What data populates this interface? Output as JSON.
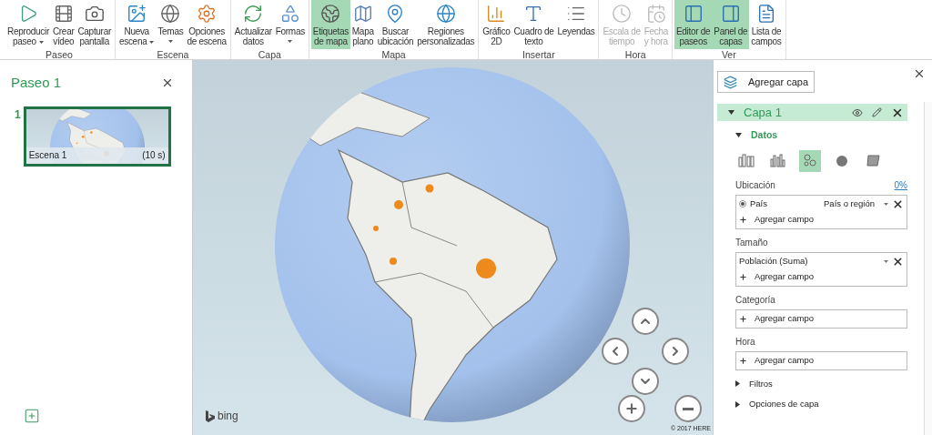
{
  "ribbon": {
    "groups": [
      {
        "label": "Paseo",
        "buttons": [
          {
            "kind": "play",
            "lines": [
              "Reproducir",
              "paseo"
            ],
            "dropdown": true,
            "selected": false,
            "disabled": false
          },
          {
            "kind": "video",
            "lines": [
              "Crear",
              "vídeo"
            ],
            "dropdown": false,
            "selected": false,
            "disabled": false
          },
          {
            "kind": "camera",
            "lines": [
              "Capturar",
              "pantalla"
            ],
            "dropdown": false,
            "selected": false,
            "disabled": false
          }
        ]
      },
      {
        "label": "Escena",
        "buttons": [
          {
            "kind": "scene",
            "lines": [
              "Nueva",
              "escena"
            ],
            "dropdown": true,
            "selected": false,
            "disabled": false
          },
          {
            "kind": "globe",
            "lines": [
              "Temas"
            ],
            "dropdown": true,
            "selected": false,
            "disabled": false
          },
          {
            "kind": "settings",
            "lines": [
              "Opciones",
              "de escena"
            ],
            "dropdown": false,
            "selected": false,
            "disabled": false
          }
        ]
      },
      {
        "label": "Capa",
        "buttons": [
          {
            "kind": "refresh",
            "lines": [
              "Actualizar",
              "datos"
            ],
            "dropdown": false,
            "selected": false,
            "disabled": false
          },
          {
            "kind": "shapes",
            "lines": [
              "Formas"
            ],
            "dropdown": true,
            "selected": false,
            "disabled": false
          }
        ]
      },
      {
        "label": "Mapa",
        "buttons": [
          {
            "kind": "labels",
            "lines": [
              "Etiquetas",
              "de mapa"
            ],
            "dropdown": false,
            "selected": true,
            "disabled": false
          },
          {
            "kind": "flat",
            "lines": [
              "Mapa",
              "plano"
            ],
            "dropdown": false,
            "selected": false,
            "disabled": false
          },
          {
            "kind": "find",
            "lines": [
              "Buscar",
              "ubicación"
            ],
            "dropdown": false,
            "selected": false,
            "disabled": false
          },
          {
            "kind": "regions",
            "lines": [
              "Regiones",
              "personalizadas"
            ],
            "dropdown": false,
            "selected": false,
            "disabled": false
          }
        ]
      },
      {
        "label": "Insertar",
        "buttons": [
          {
            "kind": "chart",
            "lines": [
              "Gráfico",
              "2D"
            ],
            "dropdown": false,
            "selected": false,
            "disabled": false
          },
          {
            "kind": "textbox",
            "lines": [
              "Cuadro de",
              "texto"
            ],
            "dropdown": false,
            "selected": false,
            "disabled": false
          },
          {
            "kind": "legend",
            "lines": [
              "Leyendas"
            ],
            "dropdown": false,
            "selected": false,
            "disabled": false
          }
        ]
      },
      {
        "label": "Hora",
        "buttons": [
          {
            "kind": "clock",
            "lines": [
              "Escala de",
              "tiempo"
            ],
            "dropdown": false,
            "selected": false,
            "disabled": true
          },
          {
            "kind": "datetime",
            "lines": [
              "Fecha",
              "y hora"
            ],
            "dropdown": false,
            "selected": false,
            "disabled": true
          }
        ]
      },
      {
        "label": "Ver",
        "buttons": [
          {
            "kind": "tour",
            "lines": [
              "Editor de",
              "paseos"
            ],
            "dropdown": false,
            "selected": true,
            "disabled": false
          },
          {
            "kind": "pane",
            "lines": [
              "Panel de",
              "capas"
            ],
            "dropdown": false,
            "selected": true,
            "disabled": false
          },
          {
            "kind": "fields",
            "lines": [
              "Lista de",
              "campos"
            ],
            "dropdown": false,
            "selected": false,
            "disabled": false
          }
        ]
      }
    ]
  },
  "tour_panel": {
    "title": "Paseo 1",
    "scenes": [
      {
        "number": "1",
        "name": "Escena 1",
        "duration": "(10 s)",
        "selected": true
      }
    ]
  },
  "map": {
    "provider": "bing",
    "copyright": "© 2017 HERE"
  },
  "layer_pane": {
    "add_button": "Agregar capa",
    "layer": {
      "name": "Capa 1",
      "expanded": true,
      "section": {
        "title": "Datos",
        "expanded": true,
        "viz_types": [
          {
            "kind": "stacked",
            "selected": false
          },
          {
            "kind": "clustered",
            "selected": false
          },
          {
            "kind": "bubble",
            "selected": true
          },
          {
            "kind": "heat",
            "selected": false
          },
          {
            "kind": "region",
            "selected": false
          }
        ],
        "wells": [
          {
            "label": "Ubicación",
            "percent": "0%",
            "fields": [
              {
                "name": "País",
                "type": "País o región",
                "selected": true
              }
            ],
            "add": "Agregar campo"
          },
          {
            "label": "Tamaño",
            "fields": [
              {
                "name": "Población (Suma)"
              }
            ],
            "add": "Agregar campo"
          },
          {
            "label": "Categoría",
            "add": "Agregar campo"
          },
          {
            "label": "Hora",
            "add": "Agregar campo"
          }
        ]
      },
      "collapsed_sections": [
        {
          "title": "Filtros",
          "expanded": false
        },
        {
          "title": "Opciones de capa",
          "expanded": false
        }
      ]
    }
  }
}
